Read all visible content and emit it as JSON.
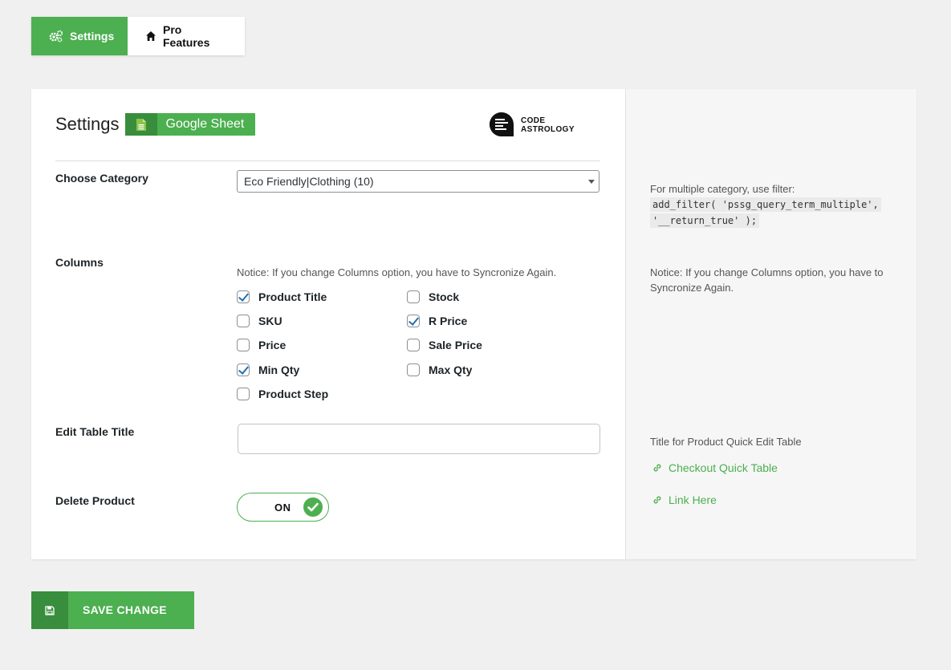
{
  "tabs": {
    "settings": "Settings",
    "pro": "Pro Features"
  },
  "header": {
    "title": "Settings",
    "badge": "Google Sheet",
    "logo_line1": "CODE",
    "logo_line2": "ASTROLOGY"
  },
  "form": {
    "category": {
      "label": "Choose Category",
      "selected": "Eco Friendly|Clothing (10)"
    },
    "columns": {
      "label": "Columns",
      "notice": "Notice: If you change Columns option, you have to Syncronize Again.",
      "options": [
        {
          "label": "Product Title",
          "checked": true
        },
        {
          "label": "Stock",
          "checked": false
        },
        {
          "label": "SKU",
          "checked": false
        },
        {
          "label": "R Price",
          "checked": true
        },
        {
          "label": "Price",
          "checked": false
        },
        {
          "label": "Sale Price",
          "checked": false
        },
        {
          "label": "Min Qty",
          "checked": true
        },
        {
          "label": "Max Qty",
          "checked": false
        },
        {
          "label": "Product Step",
          "checked": false
        }
      ]
    },
    "table_title": {
      "label": "Edit Table Title",
      "value": ""
    },
    "delete_product": {
      "label": "Delete Product",
      "state": "ON"
    }
  },
  "side": {
    "category_hint": "For multiple category, use filter:",
    "category_code_1": "add_filter( 'pssg_query_term_multiple',",
    "category_code_2": "'__return_true' );",
    "columns_notice": "Notice: If you change Columns option, you have to Syncronize Again.",
    "title_hint": "Title for Product Quick Edit Table",
    "link1": "Checkout Quick Table",
    "link2": "Link Here"
  },
  "save_button": "SAVE CHANGE",
  "colors": {
    "accent": "#4caf50",
    "accent_dark": "#388e3c",
    "checkbox": "#2271b1"
  },
  "icons": [
    "gears-icon",
    "home-icon",
    "sheet-icon",
    "check-icon",
    "link-icon",
    "save-icon"
  ]
}
